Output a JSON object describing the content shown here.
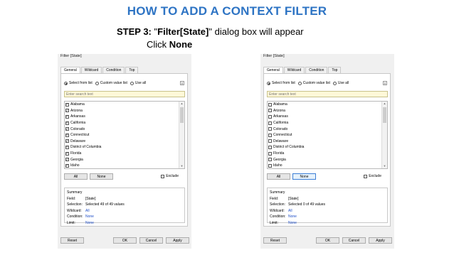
{
  "heading": "HOW TO ADD A CONTEXT FILTER",
  "instruction": {
    "step_label": "STEP 3:",
    "quote_open": "\"",
    "dialog_name": "Filter[State]",
    "rest": "\" dialog box will appear",
    "click_prefix": "Click ",
    "click_target": "None"
  },
  "dialog_title": "Filter [State]",
  "tabs": [
    "General",
    "Wildcard",
    "Condition",
    "Top"
  ],
  "radios": [
    "Select from list",
    "Custom value list",
    "Use all"
  ],
  "search_placeholder": "Enter search text",
  "states": [
    "Alabama",
    "Arizona",
    "Arkansas",
    "California",
    "Colorado",
    "Connecticut",
    "Delaware",
    "District of Columbia",
    "Florida",
    "Georgia",
    "Idaho"
  ],
  "buttons": {
    "all": "All",
    "none": "None",
    "exclude": "Exclude",
    "reset": "Reset",
    "ok": "OK",
    "cancel": "Cancel",
    "apply": "Apply"
  },
  "summary": {
    "heading": "Summary",
    "labels": [
      "Field:",
      "Selection:",
      "Wildcard:",
      "Condition:",
      "Limit:"
    ],
    "left": {
      "field": "[State]",
      "selection": "Selected 49 of 49 values",
      "wildcard": "All",
      "condition": "None",
      "limit": "None"
    },
    "right": {
      "field": "[State]",
      "selection": "Selected 0 of 49 values",
      "wildcard": "All",
      "condition": "None",
      "limit": "None"
    }
  },
  "checkbox_state": {
    "left": true,
    "right": false
  },
  "colors": {
    "heading": "#2e74c4",
    "link": "#1f4fc8"
  }
}
